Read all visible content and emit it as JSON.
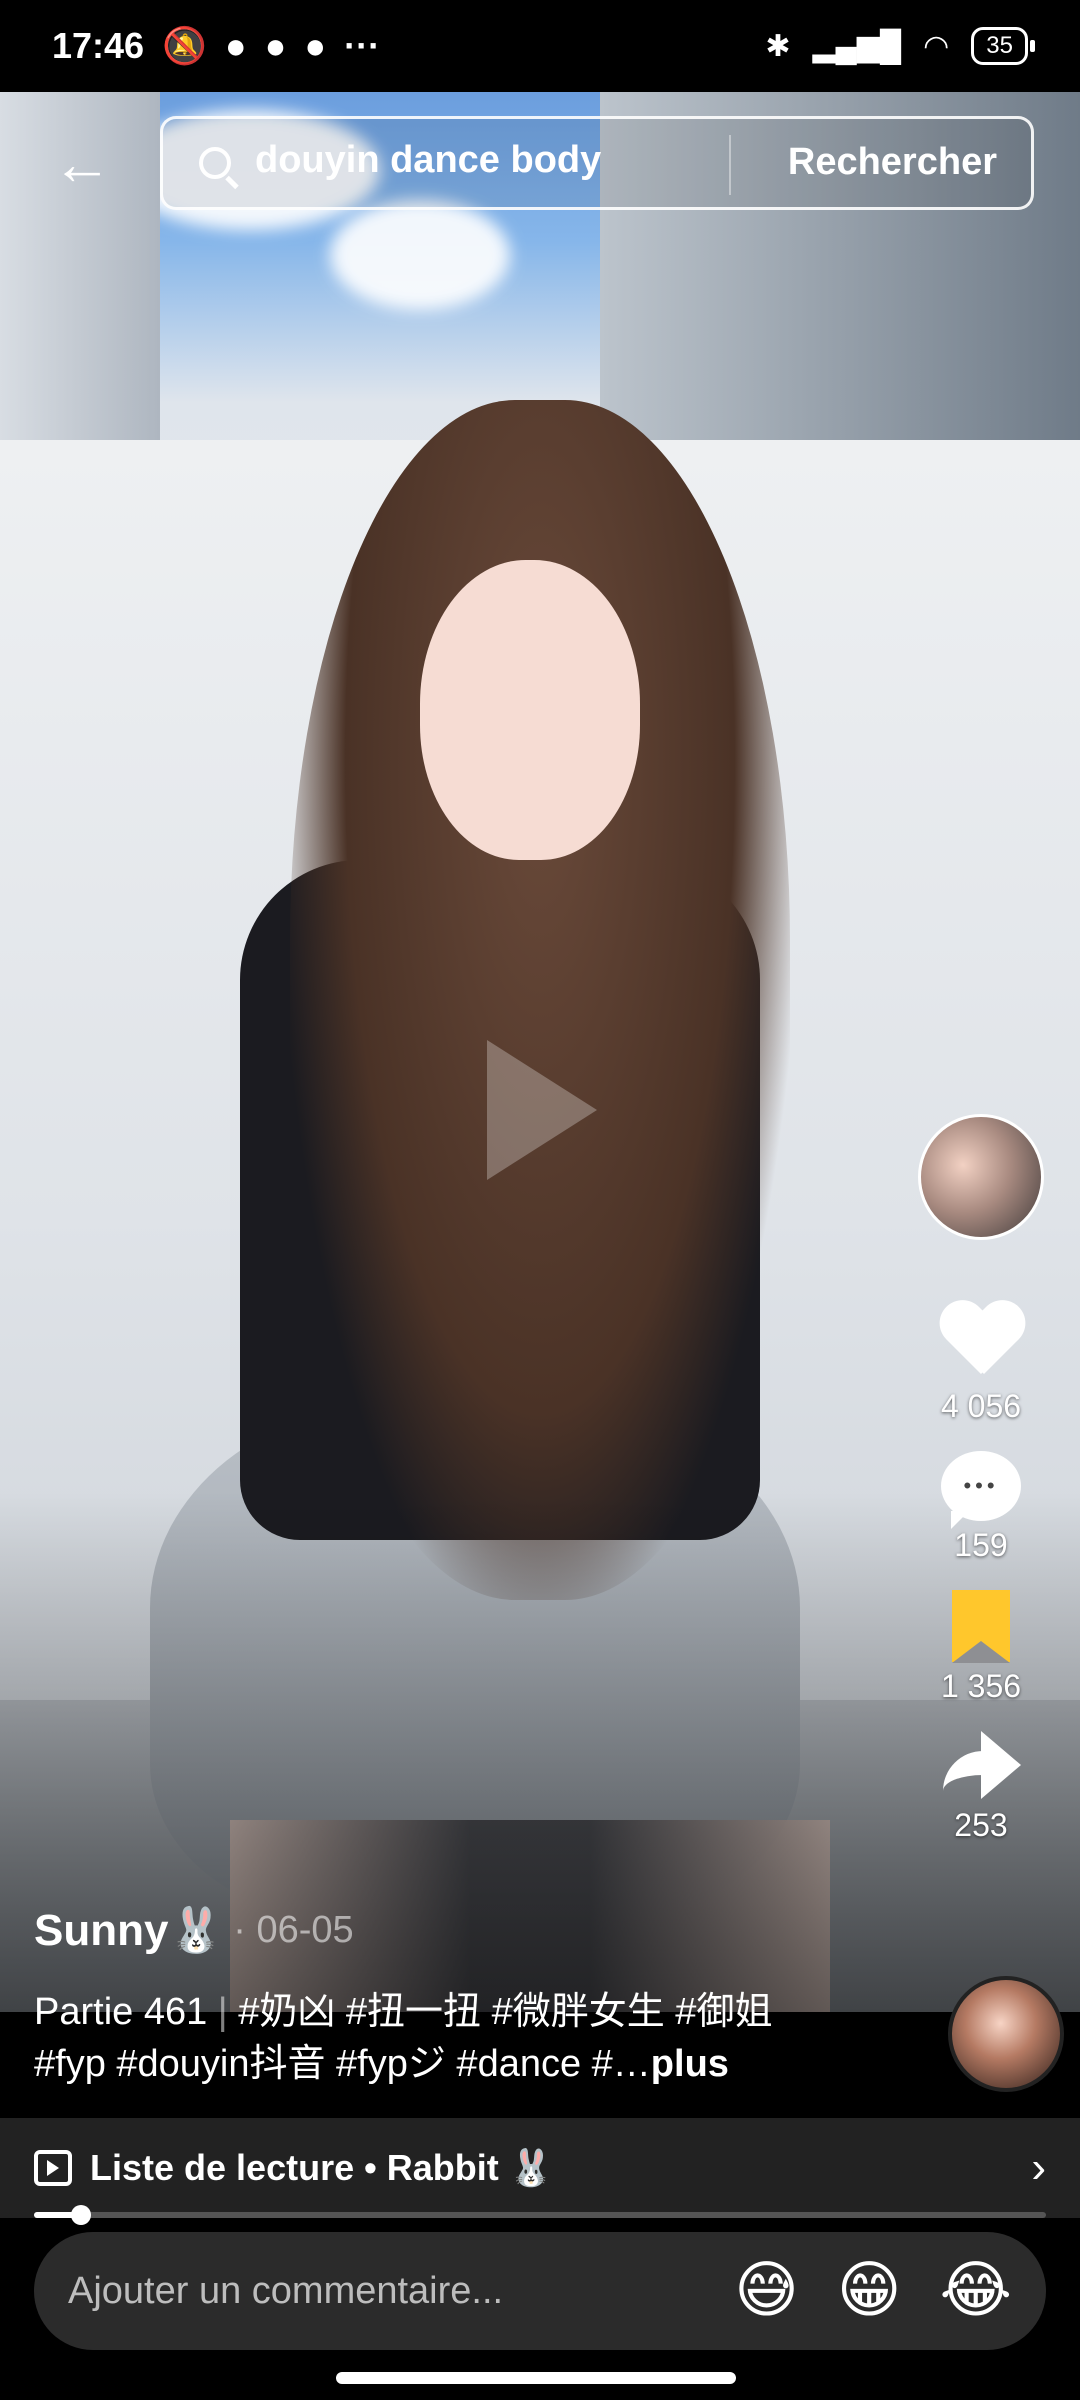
{
  "status_bar": {
    "time": "17:46",
    "left_icons": [
      "bell-off-icon",
      "app-icon",
      "app-icon",
      "app-icon",
      "more-dots-icon"
    ],
    "battery": "35"
  },
  "search": {
    "query": "douyin dance body",
    "submit_label": "Rechercher"
  },
  "actions": {
    "likes": "4 056",
    "comments": "159",
    "favorites": "1 356",
    "shares": "253",
    "favorite_color": "#ffc72c"
  },
  "post": {
    "author": "Sunny🐰",
    "date": "· 06-05",
    "part": "Partie 461",
    "tags_line1": "#奶凶 #扭一扭 #微胖女生 #御姐",
    "tags_line2": "#fyp #douyin抖音 #fypジ #dance #…",
    "more": "plus"
  },
  "playlist": {
    "label": "Liste de lecture • Rabbit 🐰"
  },
  "playback": {
    "progress": 0.046
  },
  "comment_bar": {
    "placeholder": "Ajouter un commentaire...",
    "emojis": [
      "😅",
      "😁",
      "😂"
    ]
  }
}
